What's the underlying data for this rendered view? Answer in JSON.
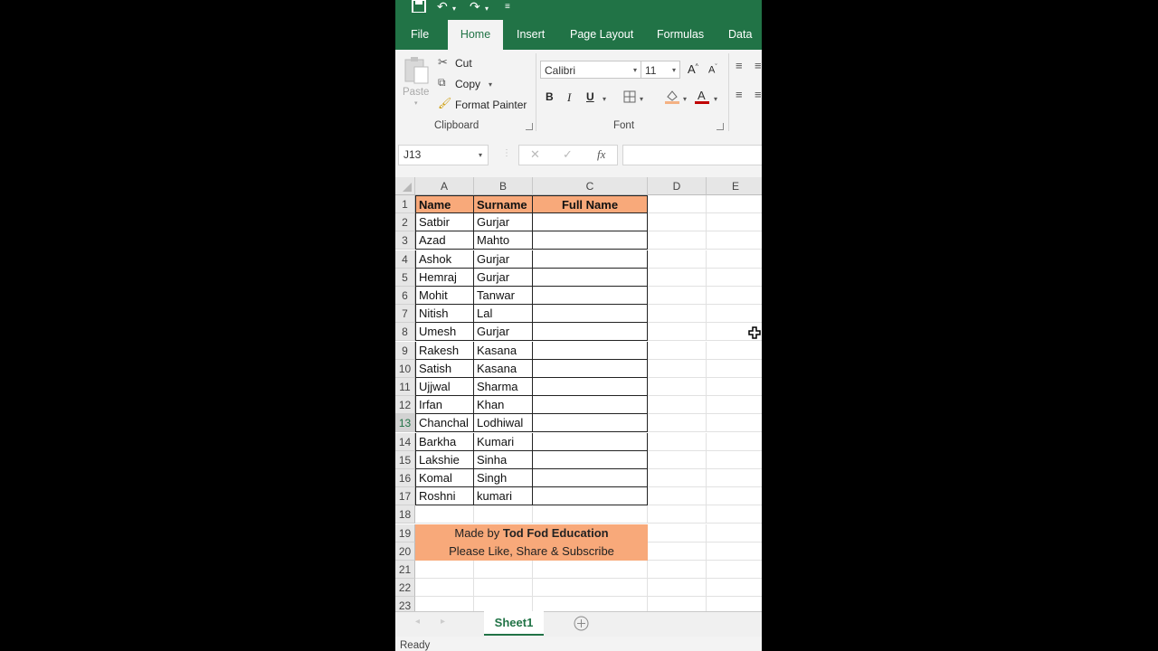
{
  "quick_access": {
    "save_icon": "save-icon",
    "undo_icon": "undo-icon",
    "redo_icon": "redo-icon",
    "customize_icon": "customize-qat-icon"
  },
  "tabs": [
    {
      "label": "File",
      "active": false
    },
    {
      "label": "Home",
      "active": true
    },
    {
      "label": "Insert",
      "active": false
    },
    {
      "label": "Page Layout",
      "active": false
    },
    {
      "label": "Formulas",
      "active": false
    },
    {
      "label": "Data",
      "active": false
    }
  ],
  "ribbon": {
    "clipboard": {
      "paste": "Paste",
      "cut": "Cut",
      "copy": "Copy",
      "format_painter": "Format Painter",
      "group_label": "Clipboard"
    },
    "font": {
      "font_name": "Calibri",
      "font_size": "11",
      "bold": "B",
      "italic": "I",
      "underline": "U",
      "group_label": "Font",
      "fill_color": "#f4b183",
      "font_color": "#c00000"
    }
  },
  "formula_bar": {
    "name_box": "J13",
    "cancel": "✕",
    "enter": "✓",
    "fx": "fx",
    "formula": ""
  },
  "grid": {
    "columns": [
      "A",
      "B",
      "C",
      "D",
      "E"
    ],
    "header_row": {
      "name": "Name",
      "surname": "Surname",
      "full_name": "Full Name"
    },
    "rows": [
      {
        "name": "Satbir",
        "surname": "Gurjar"
      },
      {
        "name": "Azad",
        "surname": "Mahto"
      },
      {
        "name": "Ashok",
        "surname": "Gurjar"
      },
      {
        "name": "Hemraj",
        "surname": "Gurjar"
      },
      {
        "name": "Mohit",
        "surname": "Tanwar"
      },
      {
        "name": "Nitish",
        "surname": "Lal"
      },
      {
        "name": "Umesh",
        "surname": "Gurjar"
      },
      {
        "name": "Rakesh",
        "surname": "Kasana"
      },
      {
        "name": "Satish",
        "surname": "Kasana"
      },
      {
        "name": "Ujjwal",
        "surname": "Sharma"
      },
      {
        "name": "Irfan",
        "surname": "Khan"
      },
      {
        "name": "Chanchal",
        "surname": "Lodhiwal"
      },
      {
        "name": "Barkha",
        "surname": "Kumari"
      },
      {
        "name": "Lakshie",
        "surname": "Sinha"
      },
      {
        "name": "Komal",
        "surname": "Singh"
      },
      {
        "name": "Roshni",
        "surname": "kumari"
      }
    ],
    "row_numbers": [
      "1",
      "2",
      "3",
      "4",
      "5",
      "6",
      "7",
      "8",
      "9",
      "10",
      "11",
      "12",
      "13",
      "14",
      "15",
      "16",
      "17",
      "18",
      "19",
      "20",
      "21",
      "22",
      "23"
    ],
    "selected_row": "13",
    "banner": {
      "line1_prefix": "Made by ",
      "line1_bold": "Tod Fod Education",
      "line2": "Please Like, Share & Subscribe"
    },
    "header_fill": "#f8a97a"
  },
  "sheets": [
    {
      "label": "Sheet1",
      "active": true
    }
  ],
  "add_sheet_icon": "plus-circle-icon",
  "status": "Ready"
}
